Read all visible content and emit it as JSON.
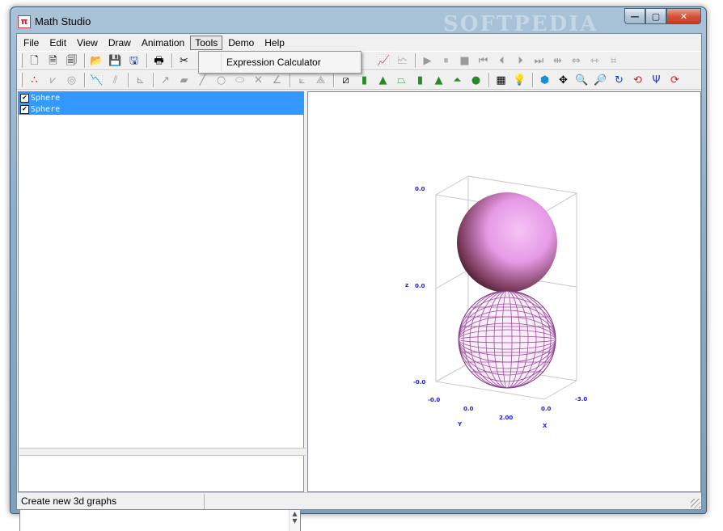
{
  "window": {
    "title": "Math Studio",
    "watermark": "SOFTPEDIA",
    "buttons": {
      "minimize": "—",
      "maximize": "▢",
      "close": "✕"
    }
  },
  "menubar": {
    "items": [
      "File",
      "Edit",
      "View",
      "Draw",
      "Animation",
      "Tools",
      "Demo",
      "Help"
    ],
    "open_menu": "Tools"
  },
  "tools_menu": {
    "items": [
      "Expression Calculator"
    ]
  },
  "toolbar1": {
    "file_icons": [
      "new-file-icon",
      "new-template-icon",
      "properties-icon",
      "open-folder-icon",
      "save-icon",
      "save-as-icon",
      "print-icon",
      "cut-icon"
    ],
    "anim_icons": [
      "play-icon",
      "pause-icon",
      "stop-icon",
      "first-frame-icon",
      "previous-frame-icon",
      "next-frame-icon",
      "last-frame-icon",
      "shrink-icon",
      "expand-icon",
      "fit-icon",
      "reset-icon"
    ]
  },
  "toolbar2": {
    "draw_icons": [
      "points-icon",
      "graph-icon",
      "polar-icon",
      "plot2d-icon",
      "plot2d-alt-icon",
      "axes-icon",
      "vector-icon",
      "region-icon",
      "line-icon",
      "circle-icon",
      "ellipse-icon",
      "cross-icon",
      "angle-icon",
      "axes3d-icon",
      "axes3d-alt-icon"
    ],
    "shape3d_icons": [
      "plane-icon",
      "cylinder-icon",
      "cone-icon",
      "truncated-cone-icon",
      "cylinder2-icon",
      "pyramid-icon",
      "cone2-icon",
      "sphere-icon"
    ],
    "view_icons": [
      "grid-icon",
      "light-icon",
      "cube-icon",
      "pan-icon",
      "zoom-in-icon",
      "zoom-out-icon",
      "rotate-icon",
      "rotate-y-icon",
      "rotate-z-icon",
      "reset-view-icon"
    ]
  },
  "tree": {
    "items": [
      {
        "label": "Sphere",
        "checked": true
      },
      {
        "label": "Sphere",
        "checked": true
      }
    ]
  },
  "plot": {
    "axis_labels": {
      "x": "X",
      "y": "Y",
      "z": "z"
    },
    "z_ticks": [
      "0.0",
      "0.0",
      "-0.0"
    ],
    "front_ticks": [
      "-0.0",
      "0.0",
      "2.00"
    ],
    "right_ticks": [
      "0.0",
      "-3.0"
    ],
    "shaded_sphere_color": "#e69ae6",
    "wire_sphere_color": "#9a4a9a"
  },
  "status": {
    "text": "Create new 3d graphs"
  }
}
